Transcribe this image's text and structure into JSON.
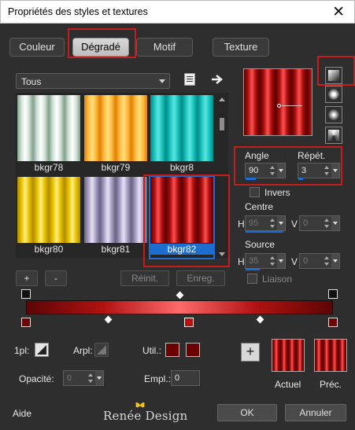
{
  "window": {
    "title": "Propriétés des styles et textures",
    "close_glyph": "✕"
  },
  "tabs": [
    {
      "label": "Couleur",
      "active": false
    },
    {
      "label": "Dégradé",
      "active": true
    },
    {
      "label": "Motif",
      "active": false
    },
    {
      "label": "Texture",
      "active": false
    }
  ],
  "gallery": {
    "category": "Tous",
    "items": [
      {
        "label": "bkgr78",
        "palette": "green"
      },
      {
        "label": "bkgr79",
        "palette": "orange"
      },
      {
        "label": "bkgr8",
        "palette": "teal"
      },
      {
        "label": "bkgr80",
        "palette": "yellow"
      },
      {
        "label": "bkgr81",
        "palette": "lilac"
      },
      {
        "label": "bkgr82",
        "palette": "red",
        "selected": true
      }
    ],
    "add_label": "+",
    "remove_label": "-",
    "reset_label": "Réinit.",
    "save_label": "Enreg."
  },
  "gradient": {
    "angle_label": "Angle",
    "angle": "90",
    "repeat_label": "Répét.",
    "repeat": "3",
    "invert_label": "Invers",
    "center_label": "Centre",
    "center_h_label": "H",
    "center_h": "95",
    "center_v_label": "V",
    "center_v": "0",
    "source_label": "Source",
    "source_h_label": "H",
    "source_h": "35",
    "source_v_label": "V",
    "source_v": "0",
    "link_label": "Liaison"
  },
  "editor": {
    "opacity_label": "1pl:",
    "arpl_label": "Arpl:",
    "util_label": "Util.:",
    "opacite_label": "Opacité:",
    "opacite_value": "0",
    "empl_label": "Empl.:",
    "empl_value": "0"
  },
  "samples": {
    "current_label": "Actuel",
    "previous_label": "Préc."
  },
  "footer": {
    "help_label": "Aide",
    "brand": "Renée Design",
    "ok_label": "OK",
    "cancel_label": "Annuler"
  },
  "colors": {
    "accent": "#1c6fd1",
    "highlight_box": "#c51c1c",
    "gradient_dark": "#5d0505",
    "gradient_light": "#ff6a6a"
  }
}
